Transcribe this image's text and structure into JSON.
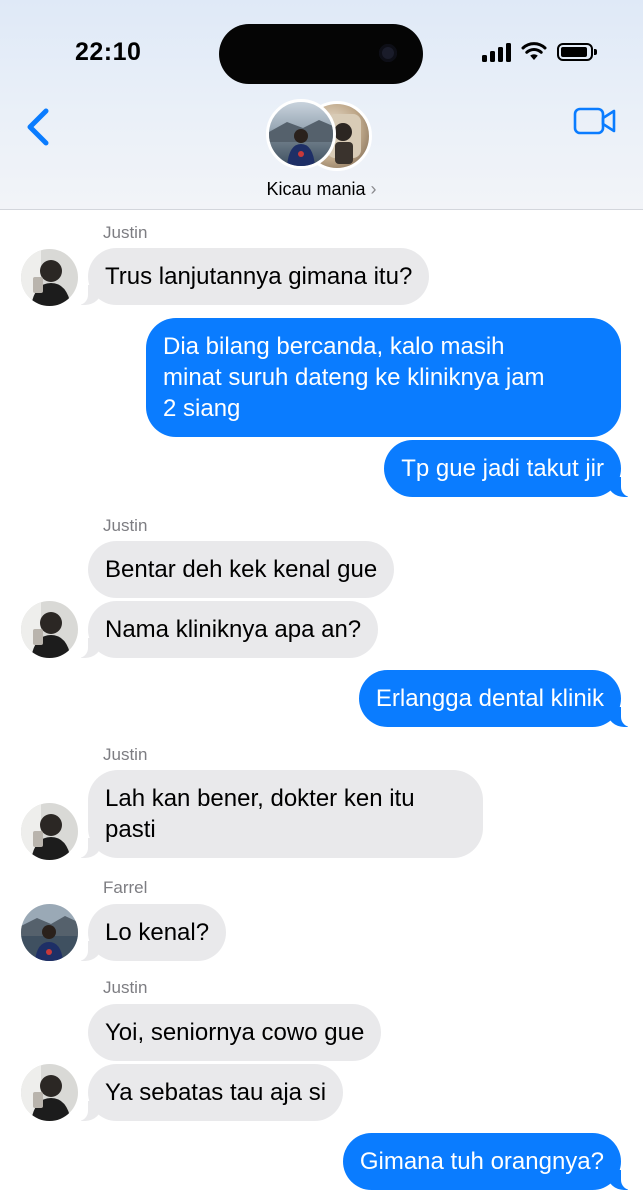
{
  "status_bar": {
    "time": "22:10"
  },
  "header": {
    "group_name": "Kicau mania",
    "chevron": "›"
  },
  "icons": {
    "back": "chevron-left-icon",
    "video": "video-camera-icon"
  },
  "colors": {
    "sent_bubble": "#0a7cff",
    "received_bubble": "#e9e9eb",
    "accent": "#0a7cff"
  },
  "messages": [
    {
      "sender": "Justin",
      "text": "Trus lanjutannya gimana itu?"
    },
    {
      "text": "Dia bilang bercanda, kalo masih"
    },
    {
      "text": "minat suruh dateng ke kliniknya jam"
    },
    {
      "text": "2 siang"
    },
    {
      "text": "Tp gue jadi takut jir"
    },
    {
      "sender": "Justin",
      "text": "Bentar deh kek kenal gue"
    },
    {
      "text": "Nama kliniknya apa an?"
    },
    {
      "text": "Erlangga dental klinik"
    },
    {
      "sender": "Justin",
      "text": "Lah kan bener, dokter ken itu"
    },
    {
      "text": "pasti"
    },
    {
      "sender": "Farrel",
      "text": "Lo kenal?"
    },
    {
      "sender": "Justin",
      "text": "Yoi, seniornya cowo gue"
    },
    {
      "text": "Ya sebatas tau aja si"
    },
    {
      "text": "Gimana tuh orangnya?"
    }
  ]
}
